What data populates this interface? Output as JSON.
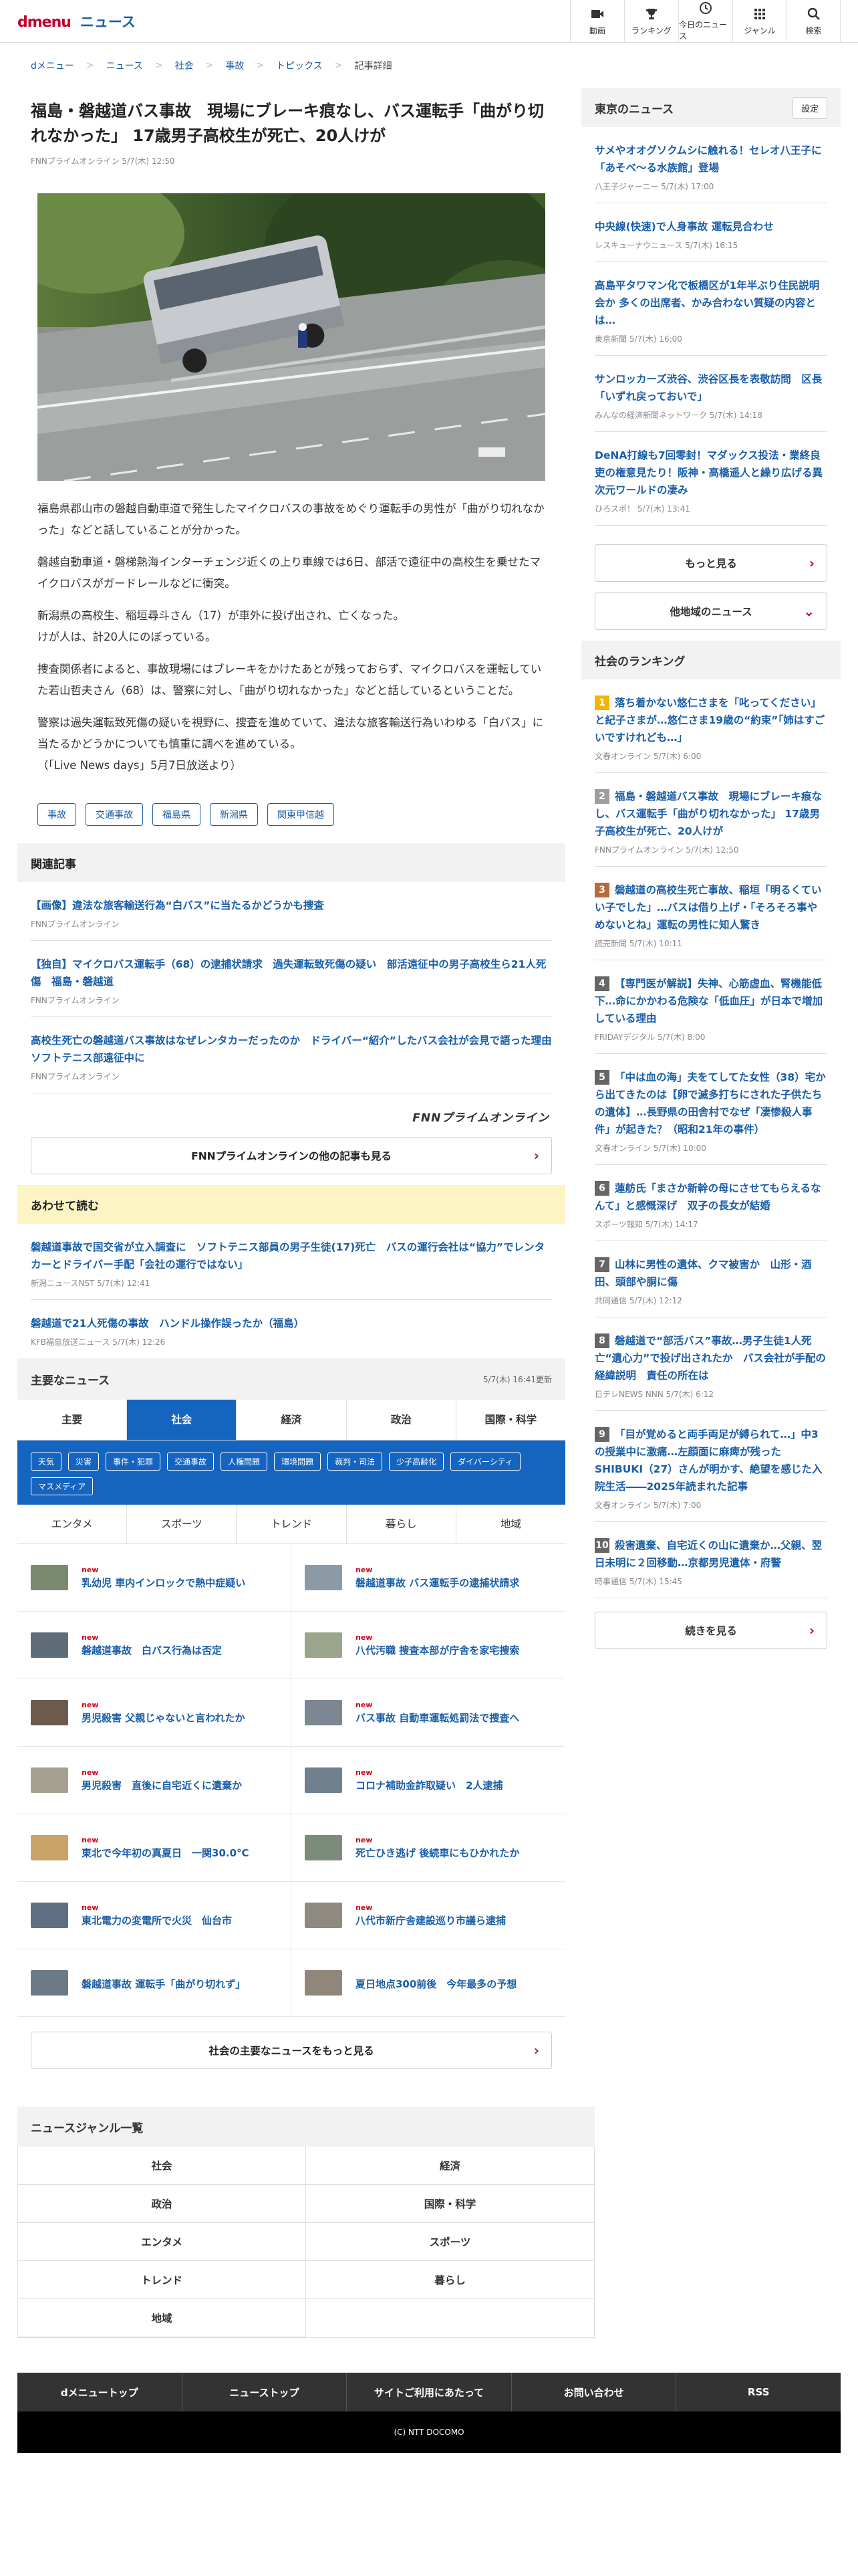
{
  "header": {
    "logo_d": "dmenu",
    "logo_news": "ニュース",
    "nav": [
      "動画",
      "ランキング",
      "今日のニュース",
      "ジャンル",
      "検索"
    ]
  },
  "breadcrumb": [
    "dメニュー",
    "ニュース",
    "社会",
    "事故",
    "トピックス",
    "記事詳細"
  ],
  "article": {
    "title": "福島・磐越道バス事故　現場にブレーキ痕なし、バス運転手「曲がり切れなかった」 17歳男子高校生が死亡、20人けが",
    "source": "FNNプライムオンライン 5/7(木) 12:50",
    "paragraphs": [
      "福島県郡山市の磐越自動車道で発生したマイクロバスの事故をめぐり運転手の男性が「曲がり切れなかった」などと話していることが分かった。",
      "磐越自動車道・磐梯熱海インターチェンジ近くの上り車線では6日、部活で遠征中の高校生を乗せたマイクロバスがガードレールなどに衝突。",
      "新潟県の高校生、稲垣尋斗さん（17）が車外に投げ出され、亡くなった。\nけが人は、計20人にのぼっている。",
      "捜査関係者によると、事故現場にはブレーキをかけたあとが残っておらず、マイクロバスを運転していた若山哲夫さん（68）は、警察に対し、「曲がり切れなかった」などと話しているということだ。",
      "警察は過失運転致死傷の疑いを視野に、捜査を進めていて、違法な旅客輸送行為いわゆる「白バス」に当たるかどうかについても慎重に調べを進めている。\n（「Live News days」5月7日放送より）"
    ],
    "tags": [
      "事故",
      "交通事故",
      "福島県",
      "新潟県",
      "関東甲信越"
    ]
  },
  "related": {
    "heading": "関連記事",
    "items": [
      {
        "title": "【画像】違法な旅客輸送行為“白バス”に当たるかどうかも捜査",
        "src": "FNNプライムオンライン"
      },
      {
        "title": "【独自】マイクロバス運転手（68）の逮捕状請求　過失運転致死傷の疑い　部活遠征中の男子高校生ら21人死傷　福島・磐越道",
        "src": "FNNプライムオンライン"
      },
      {
        "title": "高校生死亡の磐越道バス事故はなぜレンタカーだったのか　ドライバー“紹介”したバス会社が会見で語った理由　ソフトテニス部遠征中に",
        "src": "FNNプライムオンライン"
      }
    ],
    "logo": "FNNプライムオンライン",
    "more": "FNNプライムオンラインの他の記事も見る"
  },
  "also": {
    "heading": "あわせて読む",
    "items": [
      {
        "title": "磐越道事故で国交省が立入調査に　ソフトテニス部員の男子生徒(17)死亡　バスの運行会社は“協力”でレンタカーとドライバー手配「会社の運行ではない」",
        "src": "新潟ニュースNST 5/7(木) 12:41"
      },
      {
        "title": "磐越道で21人死傷の事故　ハンドル操作誤ったか（福島）",
        "src": "KFB福島放送ニュース 5/7(木) 12:26"
      }
    ]
  },
  "major": {
    "heading": "主要なニュース",
    "updated": "5/7(木) 16:41更新",
    "tabs": [
      "主要",
      "社会",
      "経済",
      "政治",
      "国際・科学"
    ],
    "subtags": [
      "天気",
      "災害",
      "事件・犯罪",
      "交通事故",
      "人権問題",
      "環境問題",
      "裁判・司法",
      "少子高齢化",
      "ダイバーシティ",
      "マスメディア"
    ],
    "tabs2": [
      "エンタメ",
      "スポーツ",
      "トレンド",
      "暮らし",
      "地域"
    ],
    "new_label": "new",
    "items": [
      {
        "t": "乳幼児 車内インロックで熱中症疑い",
        "new": true
      },
      {
        "t": "磐越道事故 バス運転手の逮捕状請求",
        "new": true
      },
      {
        "t": "磐越道事故　白バス行為は否定",
        "new": true
      },
      {
        "t": "八代汚職 捜査本部が庁舎を家宅捜索",
        "new": true
      },
      {
        "t": "男児殺害 父親じゃないと言われたか",
        "new": true
      },
      {
        "t": "バス事故 自動車運転処罰法で捜査へ",
        "new": true
      },
      {
        "t": "男児殺害　直後に自宅近くに遺棄か",
        "new": true
      },
      {
        "t": "コロナ補助金詐取疑い　2人逮捕",
        "new": true
      },
      {
        "t": "東北で今年初の真夏日　一関30.0°C",
        "new": true
      },
      {
        "t": "死亡ひき逃げ 後続車にもひかれたか",
        "new": true
      },
      {
        "t": "東北電力の変電所で火災　仙台市",
        "new": true
      },
      {
        "t": "八代市新庁舎建設巡り市議ら逮捕",
        "new": true
      },
      {
        "t": "磐越道事故 運転手「曲がり切れず」",
        "new": false
      },
      {
        "t": "夏日地点300前後　今年最多の予想",
        "new": false
      }
    ],
    "more": "社会の主要なニュースをもっと見る"
  },
  "genre": {
    "heading": "ニュースジャンル一覧",
    "items": [
      "社会",
      "経済",
      "政治",
      "国際・科学",
      "エンタメ",
      "スポーツ",
      "トレンド",
      "暮らし",
      "地域"
    ]
  },
  "sidebar": {
    "tokyo_heading": "東京のニュース",
    "settings": "設定",
    "tokyo": [
      {
        "t": "サメやオオグソクムシに触れる！セレオ八王子に「あそべ〜る水族館」登場",
        "s": "八王子ジャーニー 5/7(木) 17:00"
      },
      {
        "t": "中央線(快速)で人身事故 運転見合わせ",
        "s": "レスキューナウニュース 5/7(木) 16:15"
      },
      {
        "t": "高島平タワマン化で板橋区が1年半ぶり住民説明会か 多くの出席者、かみ合わない質疑の内容とは…",
        "s": "東京新聞 5/7(木) 16:00"
      },
      {
        "t": "サンロッカーズ渋谷、渋谷区長を表敬訪問　区長「いずれ戻っておいで」",
        "s": "みんなの経済新聞ネットワーク 5/7(木) 14:18"
      },
      {
        "t": "DeNA打線も7回零封！マダックス投法・業終良吏の権意見たり！阪神・高橋遥人と繰り広げる異次元ワールドの凄み",
        "s": "ひろスポ！ 5/7(木) 13:41"
      }
    ],
    "more": "もっと見る",
    "other_region": "他地域のニュース",
    "rank_heading": "社会のランキング",
    "rank": [
      {
        "n": "1",
        "c": "#f5b400",
        "t": "落ち着かない悠仁さまを「叱ってください」と紀子さまが…悠仁さま19歳の“約束”「姉はすごいですけれども…」",
        "s": "文春オンライン 5/7(木) 6:00"
      },
      {
        "n": "2",
        "c": "#9e9e9e",
        "t": "福島・磐越道バス事故　現場にブレーキ痕なし、バス運転手「曲がり切れなかった」 17歳男子高校生が死亡、20人けが",
        "s": "FNNプライムオンライン 5/7(木) 12:50"
      },
      {
        "n": "3",
        "c": "#b9693a",
        "t": "磐越道の高校生死亡事故、稲垣「明るくていい子でした」…バスは借り上げ・「そろそろ事やめないとね」運転の男性に知人驚き",
        "s": "読売新聞 5/7(木) 10:11"
      },
      {
        "n": "4",
        "c": "#666",
        "t": "【専門医が解説】失神、心筋虚血、腎機能低下…命にかかわる危険な「低血圧」が日本で増加している理由",
        "s": "FRIDAYデジタル 5/7(木) 8:00"
      },
      {
        "n": "5",
        "c": "#666",
        "t": "「中は血の海」夫をてしてた女性（38）宅から出てきたのは【卵で滅多打ちにされた子供たちの遺体】…長野県の田舎村でなぜ「凄惨殺人事件」が起きた？（昭和21年の事件）",
        "s": "文春オンライン 5/7(木) 10:00"
      },
      {
        "n": "6",
        "c": "#666",
        "t": "蓮舫氏「まさか新幹の母にさせてもらえるなんて」と感慨深げ　双子の長女が結婚",
        "s": "スポーツ報知 5/7(木) 14:17"
      },
      {
        "n": "7",
        "c": "#666",
        "t": "山林に男性の遺体、クマ被害か　山形・酒田、頭部や胴に傷",
        "s": "共同通信 5/7(木) 12:12"
      },
      {
        "n": "8",
        "c": "#666",
        "t": "磐越道で“部活バス”事故…男子生徒1人死亡“遺心力”で投げ出されたか　バス会社が手配の経緯説明　責任の所在は",
        "s": "日テレNEWS NNN 5/7(木) 6:12"
      },
      {
        "n": "9",
        "c": "#666",
        "t": "「目が覚めると両手両足が縛られて…」中3の授業中に激痛…左顔面に麻痺が残ったSHIBUKI（27）さんが明かす、絶望を感じた入院生活――2025年読まれた記事",
        "s": "文春オンライン 5/7(木) 7:00"
      },
      {
        "n": "10",
        "c": "#666",
        "t": "殺害遺棄、自宅近くの山に遺棄か…父親、翌日未明に２回移動…京都男児遺体・府警",
        "s": "時事通信 5/7(木) 15:45"
      }
    ],
    "rank_more": "続きを見る"
  },
  "footer": {
    "links": [
      "dメニュートップ",
      "ニューストップ",
      "サイトご利用にあたって",
      "お問い合わせ",
      "RSS"
    ],
    "copyright": "(C) NTT DOCOMO"
  }
}
